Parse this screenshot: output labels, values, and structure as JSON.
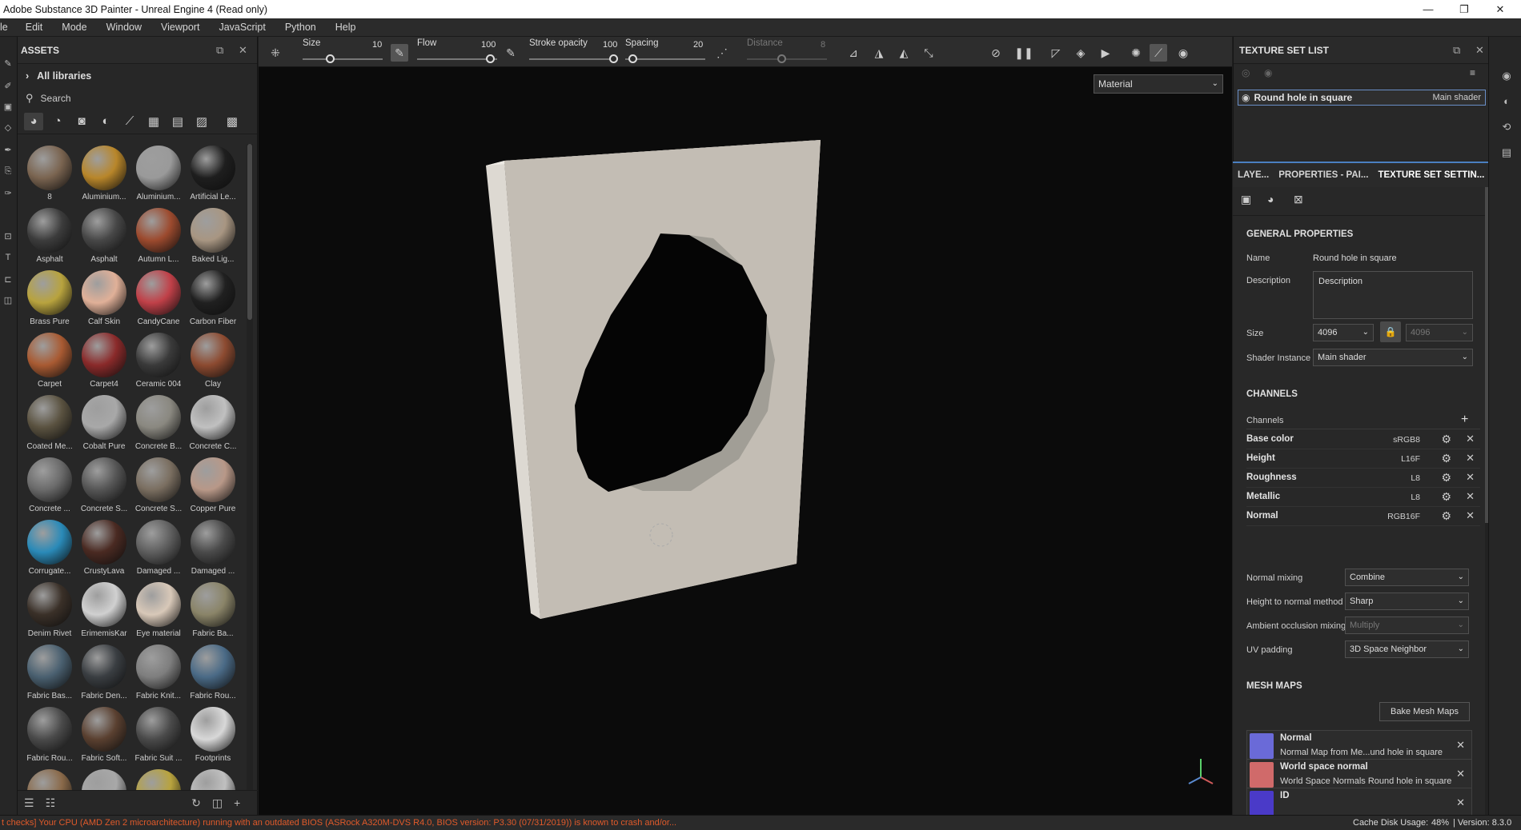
{
  "window": {
    "title": "Adobe Substance 3D Painter - Unreal Engine 4 (Read only)",
    "minimize": "—",
    "restore": "❐",
    "close": "✕"
  },
  "menu": [
    "le",
    "Edit",
    "Mode",
    "Window",
    "Viewport",
    "JavaScript",
    "Python",
    "Help"
  ],
  "assets": {
    "title": "ASSETS",
    "libraries": "All libraries",
    "search_placeholder": "Search",
    "items": [
      {
        "name": "8",
        "color": "#7a6450"
      },
      {
        "name": "Aluminium...",
        "color": "#b8862a"
      },
      {
        "name": "Aluminium...",
        "color": "#9a9a9a"
      },
      {
        "name": "Artificial Le...",
        "color": "#1e1e1e"
      },
      {
        "name": "Asphalt",
        "color": "#3c3c3c"
      },
      {
        "name": "Asphalt",
        "color": "#474747"
      },
      {
        "name": "Autumn L...",
        "color": "#9c4a2e"
      },
      {
        "name": "Baked Lig...",
        "color": "#a89682"
      },
      {
        "name": "Brass Pure",
        "color": "#b8a33e"
      },
      {
        "name": "Calf Skin",
        "color": "#e0b098"
      },
      {
        "name": "CandyCane",
        "color": "#c04048"
      },
      {
        "name": "Carbon Fiber",
        "color": "#202020"
      },
      {
        "name": "Carpet",
        "color": "#a85a32"
      },
      {
        "name": "Carpet4",
        "color": "#8a2a2a"
      },
      {
        "name": "Ceramic 004",
        "color": "#3a3a3a"
      },
      {
        "name": "Clay",
        "color": "#8c4a30"
      },
      {
        "name": "Coated Me...",
        "color": "#5a5240"
      },
      {
        "name": "Cobalt Pure",
        "color": "#a8a8a8"
      },
      {
        "name": "Concrete B...",
        "color": "#8a8880"
      },
      {
        "name": "Concrete C...",
        "color": "#c0c0c0"
      },
      {
        "name": "Concrete ...",
        "color": "#6a6a6a"
      },
      {
        "name": "Concrete S...",
        "color": "#555555"
      },
      {
        "name": "Concrete S...",
        "color": "#7a6e60"
      },
      {
        "name": "Copper Pure",
        "color": "#b89888"
      },
      {
        "name": "Corrugate...",
        "color": "#2a8ab8"
      },
      {
        "name": "CrustyLava",
        "color": "#4a2a22"
      },
      {
        "name": "Damaged ...",
        "color": "#5e5e5e"
      },
      {
        "name": "Damaged ...",
        "color": "#4a4a4a"
      },
      {
        "name": "Denim Rivet",
        "color": "#3a3028"
      },
      {
        "name": "ErimemisKar",
        "color": "#d0d0d0"
      },
      {
        "name": "Eye material",
        "color": "#d8c8b8"
      },
      {
        "name": "Fabric Ba...",
        "color": "#8a8468"
      },
      {
        "name": "Fabric Bas...",
        "color": "#4a6070"
      },
      {
        "name": "Fabric Den...",
        "color": "#3a3e42"
      },
      {
        "name": "Fabric Knit...",
        "color": "#7e7e7e"
      },
      {
        "name": "Fabric Rou...",
        "color": "#4a6a86"
      },
      {
        "name": "Fabric Rou...",
        "color": "#4a4a4a"
      },
      {
        "name": "Fabric Soft...",
        "color": "#5a4030"
      },
      {
        "name": "Fabric Suit ...",
        "color": "#4a4a4a"
      },
      {
        "name": "Footprints",
        "color": "#d8d8d8"
      },
      {
        "name": "",
        "color": "#8a6a4a"
      },
      {
        "name": "",
        "color": "#a8a8a8"
      },
      {
        "name": "",
        "color": "#b8a33e"
      },
      {
        "name": "",
        "color": "#c0c0c0"
      }
    ]
  },
  "toolbar": {
    "size_label": "Size",
    "size_value": "10",
    "flow_label": "Flow",
    "flow_value": "100",
    "stroke_label": "Stroke opacity",
    "stroke_value": "100",
    "spacing_label": "Spacing",
    "spacing_value": "20",
    "distance_label": "Distance",
    "distance_value": "8"
  },
  "viewport": {
    "material_mode": "Material"
  },
  "texture_set_list": {
    "title": "TEXTURE SET LIST",
    "item_name": "Round hole in square",
    "item_shader": "Main shader"
  },
  "tabs": [
    "LAYE...",
    "PROPERTIES - PAI...",
    "TEXTURE SET SETTIN..."
  ],
  "tss": {
    "general": "GENERAL PROPERTIES",
    "name_label": "Name",
    "name_value": "Round hole in square",
    "desc_label": "Description",
    "desc_value": "Description",
    "size_label": "Size",
    "size_value": "4096",
    "size_value2": "4096",
    "shader_label": "Shader Instance",
    "shader_value": "Main shader",
    "channels_title": "CHANNELS",
    "channels_label": "Channels",
    "channels": [
      {
        "name": "Base color",
        "format": "sRGB8"
      },
      {
        "name": "Height",
        "format": "L16F"
      },
      {
        "name": "Roughness",
        "format": "L8"
      },
      {
        "name": "Metallic",
        "format": "L8"
      },
      {
        "name": "Normal",
        "format": "RGB16F"
      }
    ],
    "normal_mixing_label": "Normal mixing",
    "normal_mixing_value": "Combine",
    "htn_label": "Height to normal method",
    "htn_value": "Sharp",
    "ao_label": "Ambient occlusion mixing",
    "ao_value": "Multiply",
    "uv_label": "UV padding",
    "uv_value": "3D Space Neighbor",
    "mesh_title": "MESH MAPS",
    "bake_button": "Bake Mesh Maps",
    "mesh_maps": [
      {
        "title": "Normal",
        "desc": "Normal Map from Me...und hole in square",
        "color": "#6a6ad8"
      },
      {
        "title": "World space normal",
        "desc": "World Space Normals Round hole in square",
        "color": "#d06a6a"
      },
      {
        "title": "ID",
        "desc": "",
        "color": "#4a3ac8"
      }
    ]
  },
  "status": {
    "warning": "t checks] Your CPU (AMD Zen 2 microarchitecture) running with an outdated BIOS (ASRock A320M-DVS R4.0, BIOS version: P3.30 (07/31/2019)) is known to crash and/or...",
    "cache_label": "Cache Disk Usage:",
    "cache_value": "48%",
    "version": "| Version: 8.3.0"
  },
  "colors": {
    "warning": "#e05a2a",
    "accent": "#4a7fc0"
  }
}
